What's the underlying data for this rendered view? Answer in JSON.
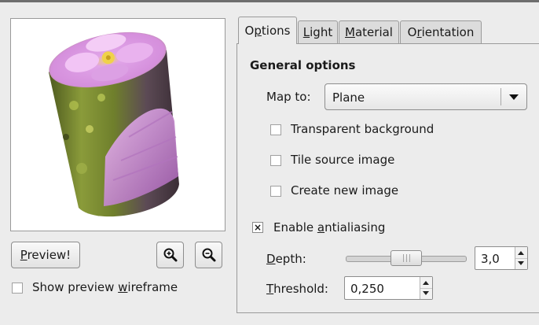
{
  "preview": {
    "preview_button": "Preview!",
    "zoom_in_icon": "zoom-in-icon",
    "zoom_out_icon": "zoom-out-icon",
    "wireframe_prefix": "Show preview ",
    "wireframe_mnemonic": "w",
    "wireframe_suffix": "ireframe",
    "wireframe_checked": false
  },
  "tabs": [
    {
      "pre": "O",
      "mn": "p",
      "post": "tions",
      "active": true
    },
    {
      "pre": "",
      "mn": "L",
      "post": "ight",
      "active": false
    },
    {
      "pre": "",
      "mn": "M",
      "post": "aterial",
      "active": false
    },
    {
      "pre": "O",
      "mn": "r",
      "post": "ientation",
      "active": false
    }
  ],
  "general": {
    "title": "General options",
    "map_to_label": "Map to:",
    "map_to_value": "Plane",
    "transparent_bg": {
      "label": "Transparent background",
      "checked": false
    },
    "tile_source": {
      "label": "Tile source image",
      "checked": false
    },
    "create_new": {
      "label": "Create new image",
      "checked": false
    },
    "antialias": {
      "pre": "Enable ",
      "mn": "a",
      "post": "ntialiasing",
      "checked": true,
      "mark": "×"
    },
    "depth": {
      "mn": "D",
      "post": "epth:",
      "value": "3,0",
      "level": 0.5
    },
    "threshold": {
      "mn": "T",
      "post": "hreshold:",
      "value": "0,250"
    }
  },
  "colors": {
    "window_bg": "#ececec",
    "preview_bg": "#ffffff",
    "flower_pink": "#c98fd6"
  }
}
